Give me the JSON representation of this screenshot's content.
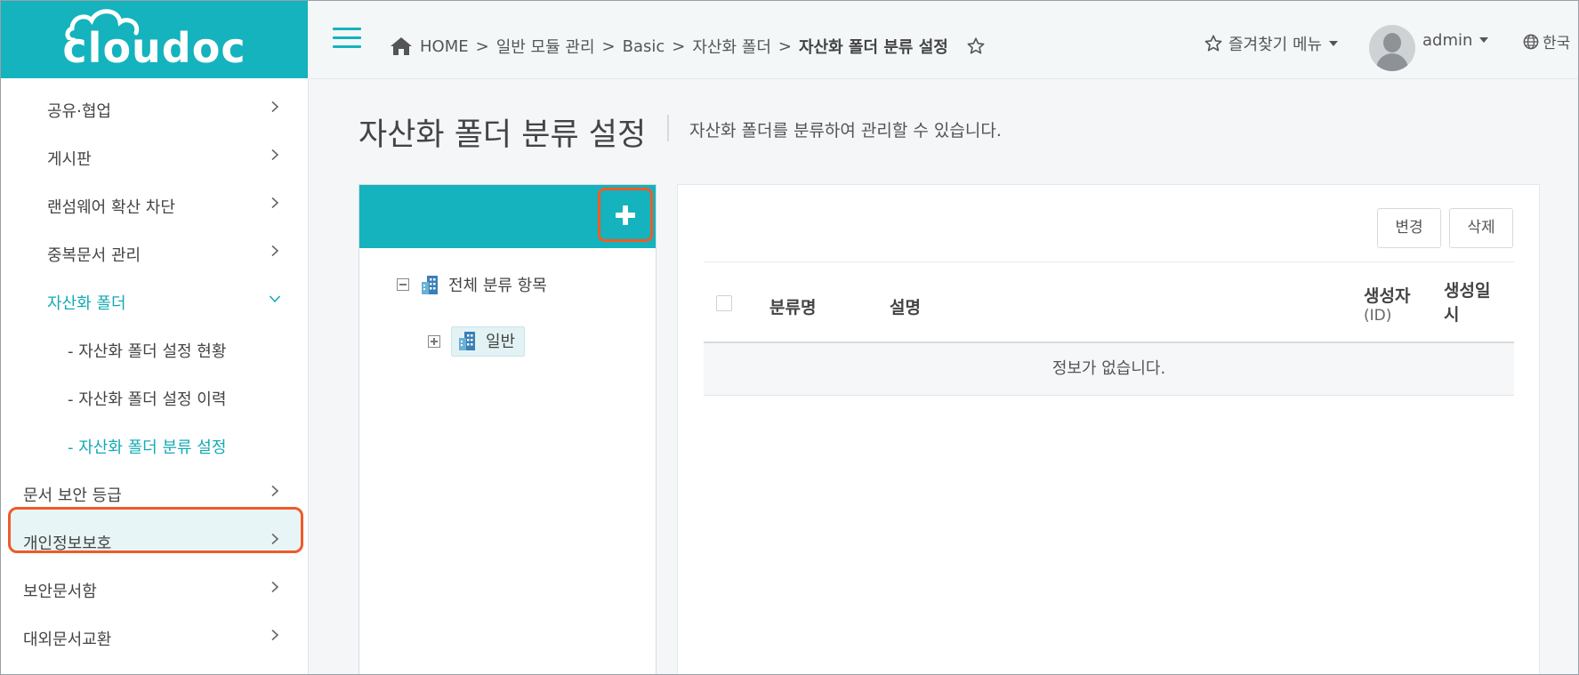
{
  "logo": {
    "text": "cloudoc"
  },
  "header": {
    "breadcrumb": [
      "HOME",
      "일반 모듈 관리",
      "Basic",
      "자산화 폴더"
    ],
    "breadcrumb_separator": ">",
    "current": "자산화 폴더 분류 설정",
    "favorites_menu": "즐겨찾기 메뉴",
    "user": "admin",
    "language": "한국"
  },
  "sidebar": {
    "items": [
      {
        "label": "공유·협업"
      },
      {
        "label": "게시판"
      },
      {
        "label": "랜섬웨어 확산 차단"
      },
      {
        "label": "중복문서 관리"
      },
      {
        "label": "자산화 폴더"
      },
      {
        "label": "- 자산화 폴더 설정 현황"
      },
      {
        "label": "- 자산화 폴더 설정 이력"
      },
      {
        "label": "- 자산화 폴더 분류 설정"
      },
      {
        "label": "문서 보안 등급"
      },
      {
        "label": "개인정보보호"
      },
      {
        "label": "보안문서함"
      },
      {
        "label": "대외문서교환"
      }
    ]
  },
  "page": {
    "title": "자산화 폴더 분류 설정",
    "description": "자산화 폴더를 분류하여 관리할 수 있습니다."
  },
  "tree": {
    "root": "전체 분류 항목",
    "children": [
      "일반"
    ]
  },
  "table": {
    "buttons": {
      "change": "변경",
      "delete": "삭제"
    },
    "columns": {
      "name": "분류명",
      "description": "설명",
      "creator": "생성자",
      "creator_sub": "(ID)",
      "created_at": "생성일시"
    },
    "empty_message": "정보가 없습니다."
  },
  "colors": {
    "accent": "#14b3bd",
    "highlight": "#f05a28"
  },
  "icons": [
    "menu-icon",
    "home-icon",
    "star-icon",
    "user-avatar-icon",
    "globe-icon",
    "chevron-right-icon",
    "chevron-down-icon",
    "plus-icon",
    "building-icon"
  ]
}
